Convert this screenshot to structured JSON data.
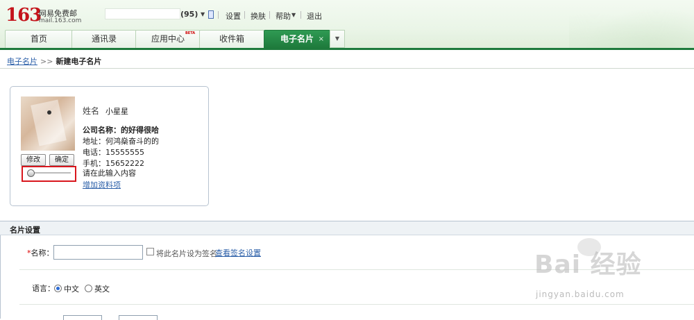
{
  "brand": {
    "logo_number": "163",
    "logo_name": "网易免费邮",
    "logo_domain": "mail.163.com"
  },
  "header": {
    "unread_count": "(95)",
    "links": {
      "settings": "设置",
      "skin": "换肤",
      "help": "帮助",
      "logout": "退出"
    }
  },
  "tabs": [
    {
      "label": "首页"
    },
    {
      "label": "通讯录"
    },
    {
      "label": "应用中心",
      "badge": "BETA"
    },
    {
      "label": "收件箱"
    },
    {
      "label": "电子名片",
      "active": true,
      "close": "×"
    }
  ],
  "breadcrumb": {
    "parent": "电子名片",
    "separator": ">>",
    "current": "新建电子名片"
  },
  "card": {
    "name_label": "姓名",
    "name_value": "小星星",
    "company": "公司名称：的好得很哈",
    "address": "地址：何鸿燊奋斗的的",
    "phone": "电话：15555555",
    "mobile": "手机：15652222",
    "placeholder_line": "请在此输入内容",
    "add_more": "增加资料项",
    "btn_edit": "修改",
    "btn_confirm": "确定",
    "slider_value": 0.05
  },
  "settings": {
    "title": "名片设置",
    "required_mark": "*",
    "name_label": "名称：",
    "name_value": "",
    "signature_checkbox": "将此名片设为签名",
    "view_signature": "查看签名设置",
    "language_label": "语言：",
    "language_options": [
      "中文",
      "英文"
    ],
    "language_selected": "中文"
  },
  "watermark": {
    "text": "Bai 经验",
    "url": "jingyan.baidu.com"
  },
  "colors": {
    "brand_red": "#c4141b",
    "tab_active": "#1e7a3c",
    "link": "#2b5fa8",
    "highlight_box": "#d9161d"
  }
}
